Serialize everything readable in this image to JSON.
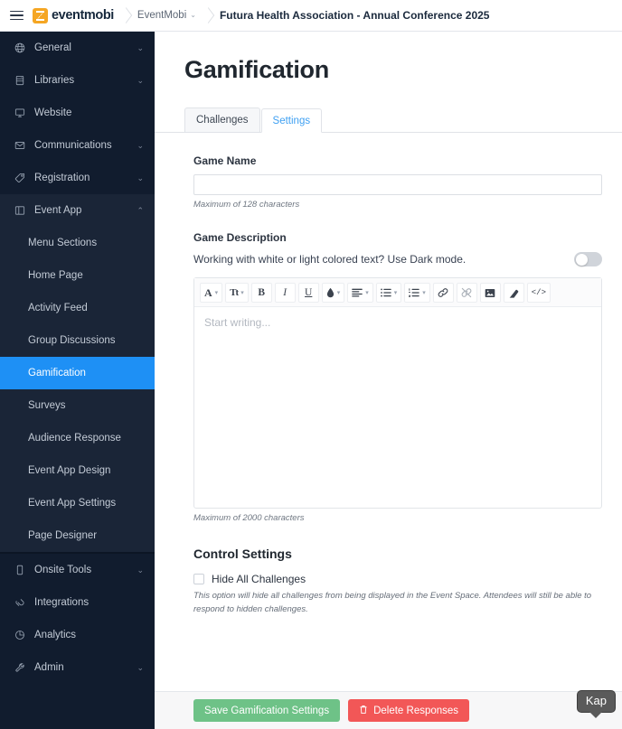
{
  "topbar": {
    "menu_icon": "hamburger-icon",
    "logo_text": "eventmobi",
    "breadcrumb_org": "EventMobi",
    "breadcrumb_event": "Futura Health Association - Annual Conference 2025",
    "caret": "⌄"
  },
  "sidebar": {
    "items": [
      {
        "label": "General",
        "icon": "globe-icon",
        "chevron": "⌄",
        "expanded": false
      },
      {
        "label": "Libraries",
        "icon": "library-icon",
        "chevron": "⌄",
        "expanded": false
      },
      {
        "label": "Website",
        "icon": "monitor-icon",
        "chevron": "",
        "expanded": false
      },
      {
        "label": "Communications",
        "icon": "envelope-icon",
        "chevron": "⌄",
        "expanded": false
      },
      {
        "label": "Registration",
        "icon": "tag-icon",
        "chevron": "⌄",
        "expanded": false
      },
      {
        "label": "Event App",
        "icon": "app-icon",
        "chevron": "⌃",
        "expanded": true
      }
    ],
    "event_app_children": [
      {
        "label": "Menu Sections",
        "active": false
      },
      {
        "label": "Home Page",
        "active": false
      },
      {
        "label": "Activity Feed",
        "active": false
      },
      {
        "label": "Group Discussions",
        "active": false
      },
      {
        "label": "Gamification",
        "active": true
      },
      {
        "label": "Surveys",
        "active": false
      },
      {
        "label": "Audience Response",
        "active": false
      },
      {
        "label": "Event App Design",
        "active": false
      },
      {
        "label": "Event App Settings",
        "active": false
      },
      {
        "label": "Page Designer",
        "active": false
      }
    ],
    "bottom_items": [
      {
        "label": "Onsite Tools",
        "icon": "mobile-icon",
        "chevron": "⌄"
      },
      {
        "label": "Integrations",
        "icon": "plug-icon",
        "chevron": ""
      },
      {
        "label": "Analytics",
        "icon": "pie-chart-icon",
        "chevron": ""
      },
      {
        "label": "Admin",
        "icon": "wrench-icon",
        "chevron": "⌄"
      }
    ],
    "active_color": "#1e90f5",
    "background": "#111c2e"
  },
  "main": {
    "page_title": "Gamification",
    "tabs": [
      {
        "label": "Challenges",
        "active": false
      },
      {
        "label": "Settings",
        "active": true
      }
    ],
    "game_name": {
      "label": "Game Name",
      "value": "",
      "placeholder": "",
      "hint": "Maximum of 128 characters"
    },
    "game_description": {
      "label": "Game Description",
      "dark_mode_text": "Working with white or light colored text? Use Dark mode.",
      "dark_mode_on": false,
      "editor_placeholder": "Start writing...",
      "hint": "Maximum of 2000 characters"
    },
    "editor_toolbar": [
      {
        "name": "font-family-icon",
        "glyph": "A",
        "caret": true
      },
      {
        "name": "font-size-icon",
        "glyph": "Tt",
        "caret": true
      },
      {
        "name": "bold-icon",
        "glyph": "B",
        "caret": false
      },
      {
        "name": "italic-icon",
        "glyph": "I",
        "caret": false
      },
      {
        "name": "underline-icon",
        "glyph": "U",
        "caret": false
      },
      {
        "name": "text-color-icon",
        "glyph": "◆",
        "caret": true
      },
      {
        "name": "align-icon",
        "glyph": "☰",
        "caret": true
      },
      {
        "name": "bullet-list-icon",
        "glyph": "≡",
        "caret": true
      },
      {
        "name": "numbered-list-icon",
        "glyph": "≣",
        "caret": true
      },
      {
        "name": "link-icon",
        "glyph": "⚭",
        "caret": false
      },
      {
        "name": "unlink-icon",
        "glyph": "⚮",
        "caret": false
      },
      {
        "name": "image-icon",
        "glyph": "❑",
        "caret": false
      },
      {
        "name": "eraser-icon",
        "glyph": "▱",
        "caret": false
      },
      {
        "name": "code-view-icon",
        "glyph": "</>",
        "caret": false
      }
    ],
    "control_settings": {
      "title": "Control Settings",
      "checkbox_label": "Hide All Challenges",
      "checked": false,
      "note": "This option will hide all challenges from being displayed in the Event Space. Attendees will still be able to respond to hidden challenges."
    }
  },
  "footer": {
    "save_label": "Save Gamification Settings",
    "delete_label": "Delete Responses",
    "delete_icon": "trash-icon",
    "save_color": "#6ec287",
    "delete_color": "#f25757"
  },
  "overlay": {
    "kap_label": "Kap"
  }
}
